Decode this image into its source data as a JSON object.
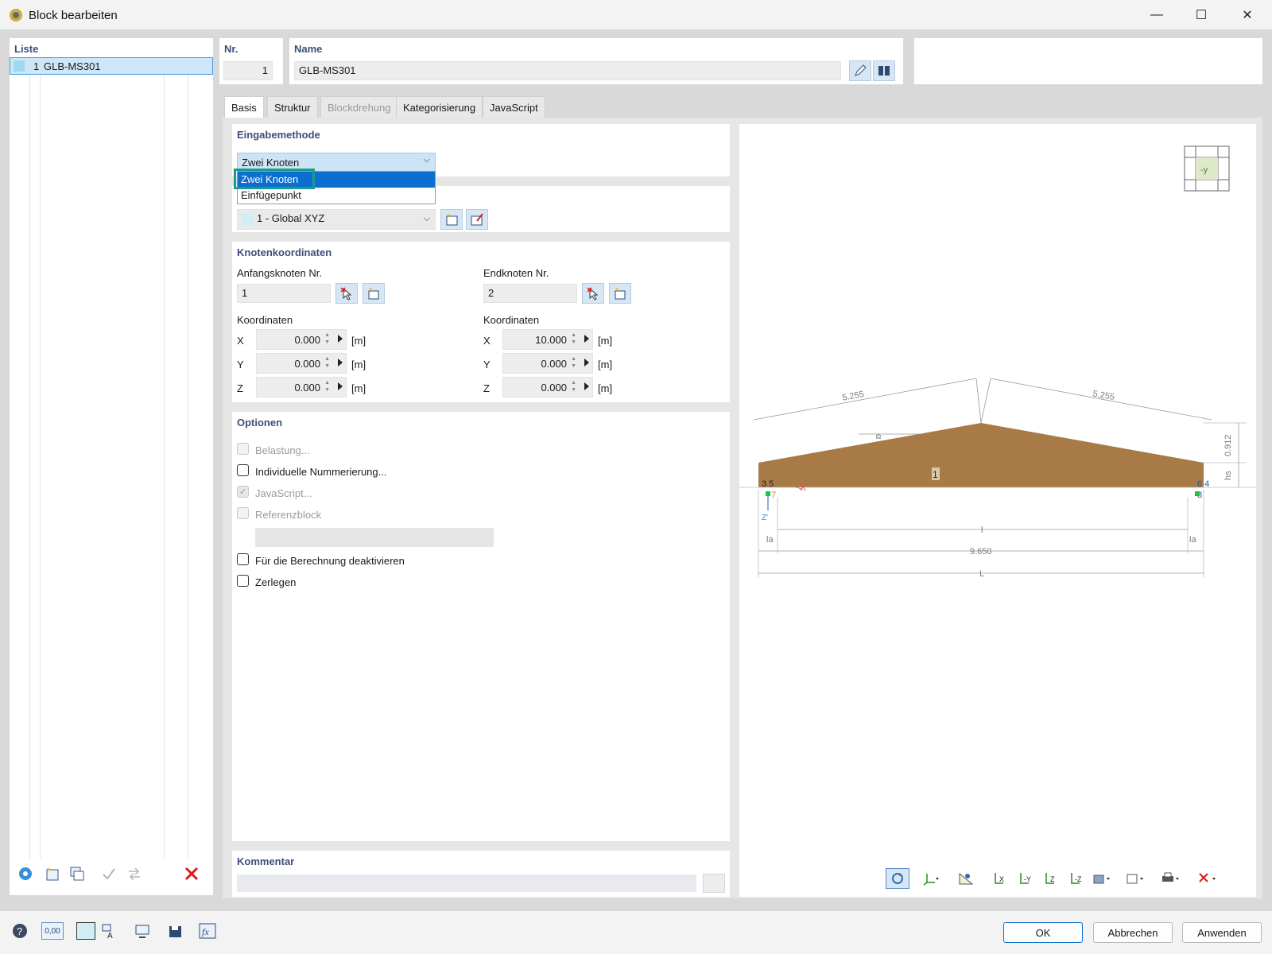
{
  "window": {
    "title": "Block bearbeiten",
    "minimize": "—",
    "maximize": "☐",
    "close": "✕"
  },
  "list": {
    "header": "Liste",
    "items": [
      {
        "num": "1",
        "name": "GLB-MS301"
      }
    ]
  },
  "nr": {
    "label": "Nr.",
    "value": "1"
  },
  "name": {
    "label": "Name",
    "value": "GLB-MS301"
  },
  "tabs": [
    "Basis",
    "Struktur",
    "Blockdrehung",
    "Kategorisierung",
    "JavaScript"
  ],
  "input_method": {
    "title": "Eingabemethode",
    "selected": "Zwei Knoten",
    "options": [
      "Zwei Knoten",
      "Einfügepunkt"
    ]
  },
  "coord_system": {
    "value": "1 - Global XYZ"
  },
  "node_coords": {
    "title": "Knotenkoordinaten",
    "start": {
      "label": "Anfangsknoten Nr.",
      "value": "1",
      "coords_label": "Koordinaten",
      "rows": [
        {
          "axis": "X",
          "value": "0.000",
          "unit": "[m]"
        },
        {
          "axis": "Y",
          "value": "0.000",
          "unit": "[m]"
        },
        {
          "axis": "Z",
          "value": "0.000",
          "unit": "[m]"
        }
      ]
    },
    "end": {
      "label": "Endknoten Nr.",
      "value": "2",
      "coords_label": "Koordinaten",
      "rows": [
        {
          "axis": "X",
          "value": "10.000",
          "unit": "[m]"
        },
        {
          "axis": "Y",
          "value": "0.000",
          "unit": "[m]"
        },
        {
          "axis": "Z",
          "value": "0.000",
          "unit": "[m]"
        }
      ]
    }
  },
  "options": {
    "title": "Optionen",
    "belastung": "Belastung...",
    "nummerierung": "Individuelle Nummerierung...",
    "javascript": "JavaScript...",
    "referenzblock": "Referenzblock",
    "deaktivieren": "Für die Berechnung deaktivieren",
    "zerlegen": "Zerlegen"
  },
  "comment": {
    "title": "Kommentar",
    "value": ""
  },
  "preview": {
    "view_label": "-y",
    "dim_left": "5.255",
    "dim_right": "5.255",
    "dim_height": "0.912",
    "dim_hs": "hs",
    "dim_alpha": "α",
    "dim_l": "l",
    "dim_la": "la",
    "dim_inner": "9.650",
    "dim_L": "L",
    "member_no": "1",
    "nodes_left": "3 5",
    "node7": "7",
    "nodes_right": "6 4",
    "node8": "8",
    "z_label": "Z'"
  },
  "buttons": {
    "ok": "OK",
    "cancel": "Abbrechen",
    "apply": "Anwenden"
  },
  "status": {
    "units": "0,00"
  },
  "colors": {
    "accent": "#0b6ed0",
    "wood": "#a87a45",
    "highlight": "#1a9c8c",
    "section": "#3c4f78"
  }
}
